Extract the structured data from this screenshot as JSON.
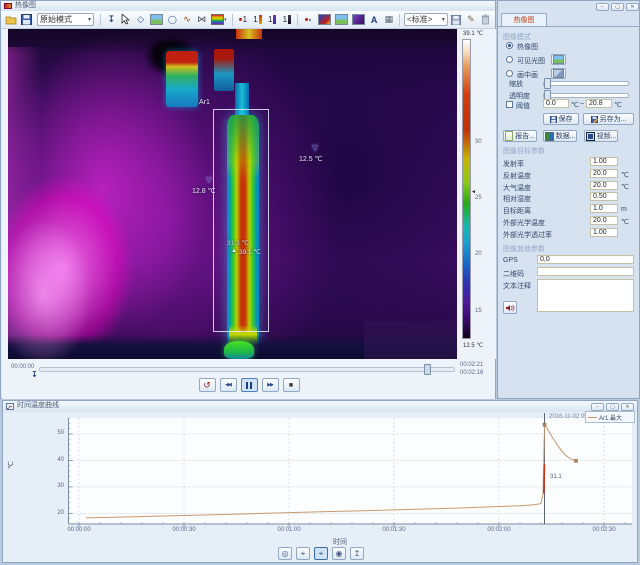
{
  "icons": {
    "dropdown": "▾",
    "anchor": "↧",
    "spot": "◇",
    "ellipse": "◯",
    "polyline": "∿",
    "profile": "⋈",
    "letter_a": "A",
    "grid": "▦",
    "edit": "✎",
    "replay": "↺",
    "rewind": "◀◀",
    "forward": "▶▶",
    "stop": "■",
    "marker_down": "▽",
    "marker_up": "▲",
    "eye": "◎",
    "eye_filled": "◉",
    "crosshair": "⌖",
    "arrow_up": "↥",
    "minimize": "−",
    "maximize": "▢",
    "close": "✕",
    "colorbar_pointer": "◄"
  },
  "thermal_window": {
    "title": "热像图",
    "toolbar": {
      "mode_select": "原始模式",
      "fusion_select": "<标准>"
    },
    "overlay": {
      "roi_label": "Ar1",
      "left_marker_temp": "12.8 ℃",
      "right_marker_temp": "12.5 ℃",
      "center_temp_1": "31.3 ℃",
      "center_temp_2": "39.1 ℃"
    },
    "colorbar": {
      "max": "39.1 ℃",
      "min": "12.5 ℃",
      "ticks": [
        "30",
        "25",
        "20",
        "15"
      ]
    },
    "timeline": {
      "start": "00:00:00",
      "total": "00:02:21",
      "current": "00:02:16"
    }
  },
  "panel": {
    "tab_label": "热像图",
    "mode_group": {
      "title": "图像模式",
      "radio_thermal": "热像图",
      "radio_visible": "可见光图",
      "radio_pip": "画中画",
      "zoom_label": "缩放",
      "opacity_label": "透明度",
      "threshold_label": "阈值",
      "threshold_min": "0.0",
      "threshold_max": "20.8",
      "unit_c": "℃",
      "range_sep": "~"
    },
    "buttons": {
      "save": "保存",
      "save_as": "另存为...",
      "report": "报告...",
      "data": "数据...",
      "video": "视频..."
    },
    "target_group": {
      "title": "图像目标参数",
      "rows": [
        {
          "label": "发射率",
          "value": "1.00",
          "unit": ""
        },
        {
          "label": "反射温度",
          "value": "20.0",
          "unit": "℃"
        },
        {
          "label": "大气温度",
          "value": "20.0",
          "unit": "℃"
        },
        {
          "label": "相对湿度",
          "value": "0.50",
          "unit": ""
        },
        {
          "label": "目标距离",
          "value": "1.0",
          "unit": "m"
        },
        {
          "label": "外部光学温度",
          "value": "20.0",
          "unit": "℃"
        },
        {
          "label": "外部光学透过率",
          "value": "1.00",
          "unit": ""
        }
      ]
    },
    "other_group": {
      "title": "图像其他参数",
      "gps_label": "GPS",
      "gps_value": "0,0",
      "qr_label": "二维码",
      "qr_value": "",
      "note_label": "文本注释",
      "note_value": ""
    }
  },
  "chart_window": {
    "title": "时间温度曲线"
  },
  "chart_data": {
    "type": "line",
    "title": "时间温度曲线",
    "xlabel": "时间",
    "ylabel": "℃",
    "x_ticks": [
      {
        "label": "00:00:00",
        "seconds": 0
      },
      {
        "label": "00:00:30",
        "seconds": 30
      },
      {
        "label": "00:01:00",
        "seconds": 60
      },
      {
        "label": "00:01:30",
        "seconds": 90
      },
      {
        "label": "00:02:00",
        "seconds": 120
      },
      {
        "label": "00:02:30",
        "seconds": 150
      }
    ],
    "y_ticks": [
      20,
      30,
      40,
      50
    ],
    "ylim": [
      16,
      56
    ],
    "xlim_seconds": [
      -3,
      158
    ],
    "grid": true,
    "legend": {
      "position": "top-right",
      "entries": [
        {
          "label": "Ar1.最大",
          "color": "#c89a6e"
        }
      ]
    },
    "series": [
      {
        "name": "Ar1.最大",
        "color": "#c89a6e",
        "points": [
          [
            2,
            18.3
          ],
          [
            12,
            18.6
          ],
          [
            24,
            19.0
          ],
          [
            36,
            19.4
          ],
          [
            48,
            19.8
          ],
          [
            60,
            20.3
          ],
          [
            72,
            20.7
          ],
          [
            84,
            21.1
          ],
          [
            96,
            21.6
          ],
          [
            108,
            22.0
          ],
          [
            118,
            22.5
          ],
          [
            126,
            22.9
          ],
          [
            130,
            23.3
          ],
          [
            132,
            23.7
          ],
          [
            132.6,
            27.5
          ],
          [
            133,
            53.5
          ],
          [
            134,
            51.5
          ],
          [
            135,
            49.3
          ],
          [
            136,
            47.2
          ],
          [
            137,
            45.2
          ],
          [
            138,
            43.4
          ],
          [
            139,
            42.0
          ],
          [
            140,
            41.0
          ],
          [
            141,
            40.3
          ],
          [
            142,
            39.8
          ]
        ]
      }
    ],
    "highlight_segment": {
      "color": "#d03214",
      "points": [
        [
          132.8,
          27.5
        ],
        [
          133,
          38.5
        ]
      ]
    },
    "cursor_seconds": 133,
    "cursor_annotation": "2016-11-02 09:59:39",
    "value_label": {
      "text": "31.1",
      "seconds": 133.5,
      "value": 33
    },
    "point_markers": [
      [
        133,
        53.5
      ],
      [
        142,
        39.8
      ]
    ]
  }
}
